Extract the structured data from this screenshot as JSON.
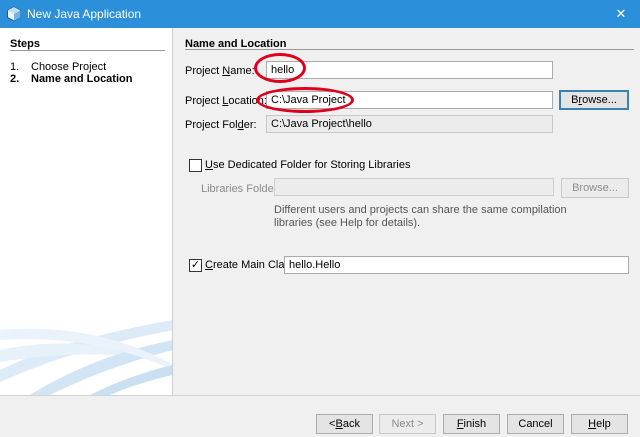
{
  "window": {
    "title": "New Java Application",
    "close_glyph": "✕"
  },
  "steps": {
    "title": "Steps",
    "items": [
      {
        "num": "1.",
        "label": "Choose Project"
      },
      {
        "num": "2.",
        "label": "Name and Location"
      }
    ]
  },
  "section": {
    "title": "Name and Location"
  },
  "project_name": {
    "label_pre": "Project ",
    "label_mnemonic": "N",
    "label_post": "ame:",
    "value": "hello"
  },
  "project_location": {
    "label_pre": "Project ",
    "label_mnemonic": "L",
    "label_post": "ocation:",
    "value": "C:\\Java Project",
    "browse_pre": "B",
    "browse_mnemonic": "r",
    "browse_post": "owse..."
  },
  "project_folder": {
    "label_pre": "Project Fol",
    "label_mnemonic": "d",
    "label_post": "er:",
    "value": "C:\\Java Project\\hello"
  },
  "dedicated_folder": {
    "label_mnemonic": "U",
    "label_post": "se Dedicated Folder for Storing Libraries",
    "checked": false
  },
  "libraries_folder": {
    "label": "Libraries Folder:",
    "value": "",
    "browse_label": "Browse...",
    "hint": "Different users and projects can share the same compilation libraries (see Help for details)."
  },
  "main_class": {
    "label_mnemonic": "C",
    "label_post": "reate Main Class",
    "checked": true,
    "check_glyph": "✓",
    "value": "hello.Hello"
  },
  "footer": {
    "back_glyph": "< ",
    "back_mnemonic": "B",
    "back_post": "ack",
    "next_label": "Next >",
    "finish_mnemonic": "F",
    "finish_post": "inish",
    "cancel_label": "Cancel",
    "help_mnemonic": "H",
    "help_post": "elp"
  },
  "colors": {
    "titlebar": "#2b8fd9",
    "highlight_circle": "#e0001b"
  }
}
